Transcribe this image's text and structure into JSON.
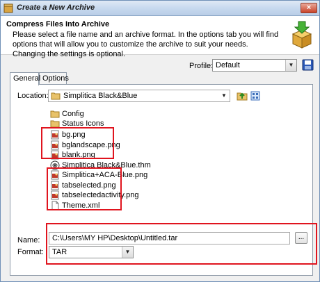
{
  "window": {
    "title": "Create a New Archive",
    "close_symbol": "×"
  },
  "header": {
    "title": "Compress Files Into Archive",
    "description": "Please select a file name and an archive format. In the options tab you will find options that will allow you to customize the archive to suit your needs. Changing the settings is optional."
  },
  "profile": {
    "label": "Profile:",
    "value": "Default"
  },
  "tabs": [
    {
      "label": "General"
    },
    {
      "label": "Options"
    }
  ],
  "location": {
    "label": "Location:",
    "value": "Simplitica Black&Blue"
  },
  "files": [
    {
      "name": "Config",
      "icon": "folder-icon"
    },
    {
      "name": "Status Icons",
      "icon": "folder-icon"
    },
    {
      "name": "bg.png",
      "icon": "image-file-icon"
    },
    {
      "name": "bglandscape.png",
      "icon": "image-file-icon"
    },
    {
      "name": "blank.png",
      "icon": "image-file-icon"
    },
    {
      "name": "Simplitica Black&Blue.thm",
      "icon": "theme-file-icon"
    },
    {
      "name": "Simplitica+ACA-Blue.png",
      "icon": "image-file-icon"
    },
    {
      "name": "tabselected.png",
      "icon": "image-file-icon"
    },
    {
      "name": "tabselectedactivity.png",
      "icon": "image-file-icon"
    },
    {
      "name": "Theme.xml",
      "icon": "document-icon"
    }
  ],
  "name_field": {
    "label": "Name:",
    "value": "C:\\Users\\MY HP\\Desktop\\Untitled.tar",
    "browse_label": "..."
  },
  "format_field": {
    "label": "Format:",
    "value": "TAR"
  },
  "colors": {
    "highlight": "#e0141e",
    "title_bar": "#c6d8ee",
    "folder": "#e8c26a"
  }
}
